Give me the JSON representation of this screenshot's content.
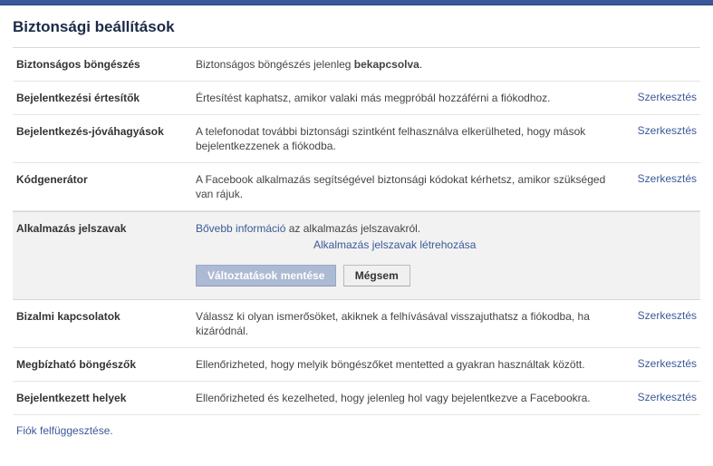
{
  "page": {
    "title": "Biztonsági beállítások",
    "edit_label": "Szerkesztés",
    "suspend_link": "Fiók felfüggesztése."
  },
  "rows": {
    "secure_browsing": {
      "label": "Biztonságos böngészés",
      "desc_prefix": "Biztonságos böngészés jelenleg ",
      "desc_bold": "bekapcsolva",
      "desc_suffix": "."
    },
    "login_notifications": {
      "label": "Bejelentkezési értesítők",
      "desc": "Értesítést kaphatsz, amikor valaki más megpróbál hozzáférni a fiókodhoz."
    },
    "login_approvals": {
      "label": "Bejelentkezés-jóváhagyások",
      "desc": "A telefonodat további biztonsági szintként felhasználva elkerülheted, hogy mások bejelentkezzenek a fiókodba."
    },
    "code_generator": {
      "label": "Kódgenerátor",
      "desc": "A Facebook alkalmazás segítségével biztonsági kódokat kérhetsz, amikor szükséged van rájuk."
    },
    "app_passwords": {
      "label": "Alkalmazás jelszavak",
      "more_info": "Bővebb információ",
      "more_info_tail": " az alkalmazás jelszavakról.",
      "create_link": "Alkalmazás jelszavak létrehozása",
      "save_btn": "Változtatások mentése",
      "cancel_btn": "Mégsem"
    },
    "trusted_contacts": {
      "label": "Bizalmi kapcsolatok",
      "desc": "Válassz ki olyan ismerősöket, akiknek a felhívásával visszajuthatsz a fiókodba, ha kizáródnál."
    },
    "trusted_browsers": {
      "label": "Megbízható böngészők",
      "desc": "Ellenőrizheted, hogy melyik böngészőket mentetted a gyakran használtak között."
    },
    "active_sessions": {
      "label": "Bejelentkezett helyek",
      "desc": "Ellenőrizheted és kezelheted, hogy jelenleg hol vagy bejelentkezve a Facebookra."
    }
  }
}
